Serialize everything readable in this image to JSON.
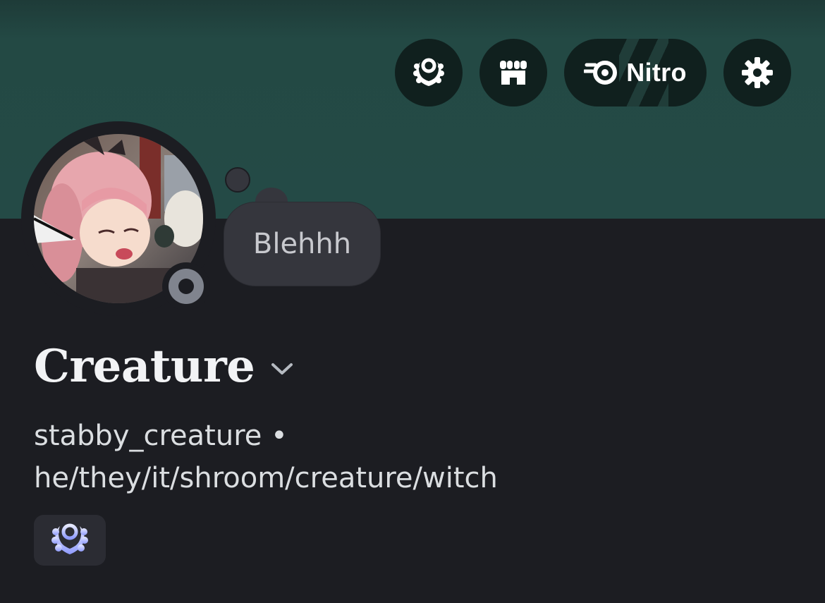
{
  "header": {
    "actions": [
      {
        "name": "quests",
        "icon": "laurel-wreath-icon"
      },
      {
        "name": "shop",
        "icon": "shop-icon"
      },
      {
        "name": "nitro",
        "icon": "nitro-icon",
        "label": "Nitro"
      },
      {
        "name": "settings",
        "icon": "gear-icon"
      }
    ],
    "banner_color": "#244a46"
  },
  "profile": {
    "avatar_icon": "avatar-image",
    "status": "idle-offline",
    "custom_status": "Blehhh",
    "display_name": "Creature",
    "username": "stabby_creature",
    "separator": "•",
    "pronouns": "he/they/it/shroom/creature/witch",
    "badges": [
      {
        "icon": "laurel-wreath-badge-icon"
      }
    ]
  },
  "colors": {
    "background": "#1c1d22",
    "accent_badge": "#9ea8ff"
  }
}
